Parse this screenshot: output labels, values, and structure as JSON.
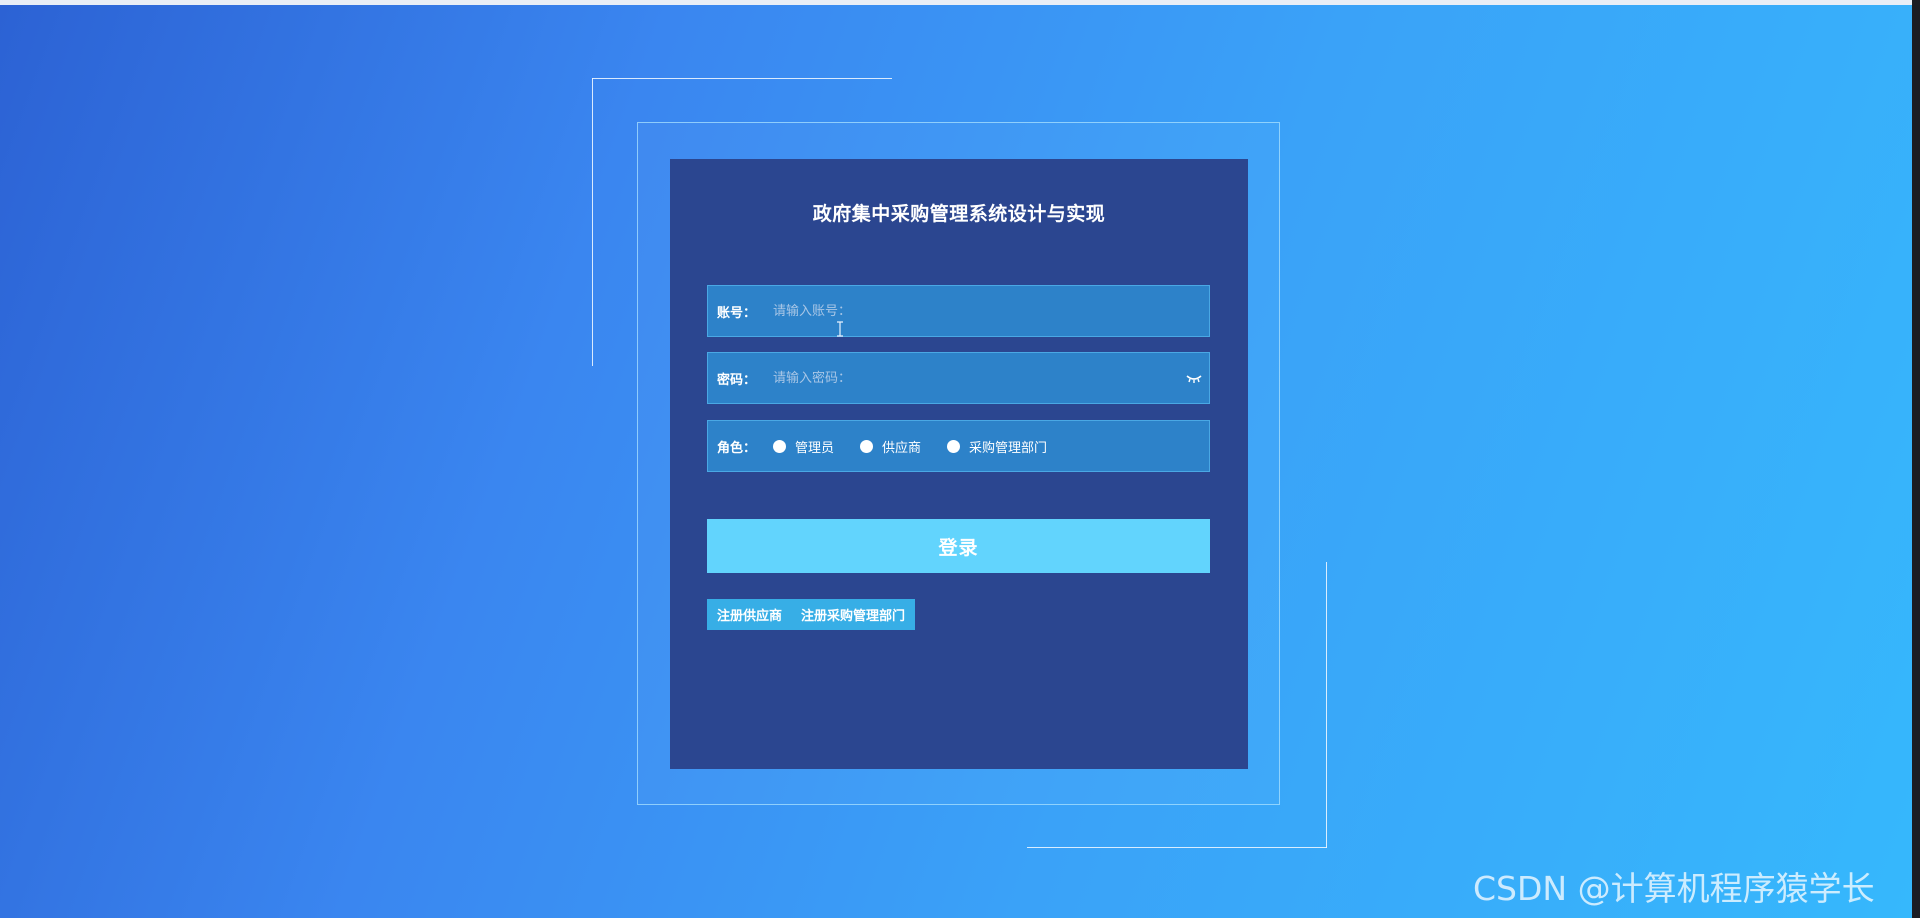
{
  "login": {
    "title": "政府集中采购管理系统设计与实现",
    "account": {
      "label": "账号：",
      "placeholder": "请输入账号："
    },
    "password": {
      "label": "密码：",
      "placeholder": "请输入密码："
    },
    "role": {
      "label": "角色：",
      "options": [
        {
          "label": "管理员"
        },
        {
          "label": "供应商"
        },
        {
          "label": "采购管理部门"
        }
      ]
    },
    "login_button": "登录",
    "register_links": [
      "注册供应商",
      "注册采购管理部门"
    ]
  },
  "watermark": "CSDN @计算机程序猿学长",
  "icons": {
    "password_toggle": "eye-closed-icon",
    "cursor": "text-cursor-icon"
  },
  "colors": {
    "panel": "#2b4690",
    "field": "#2d82c9",
    "login_button": "#62d4fd",
    "register_bar": "#37aee6"
  }
}
